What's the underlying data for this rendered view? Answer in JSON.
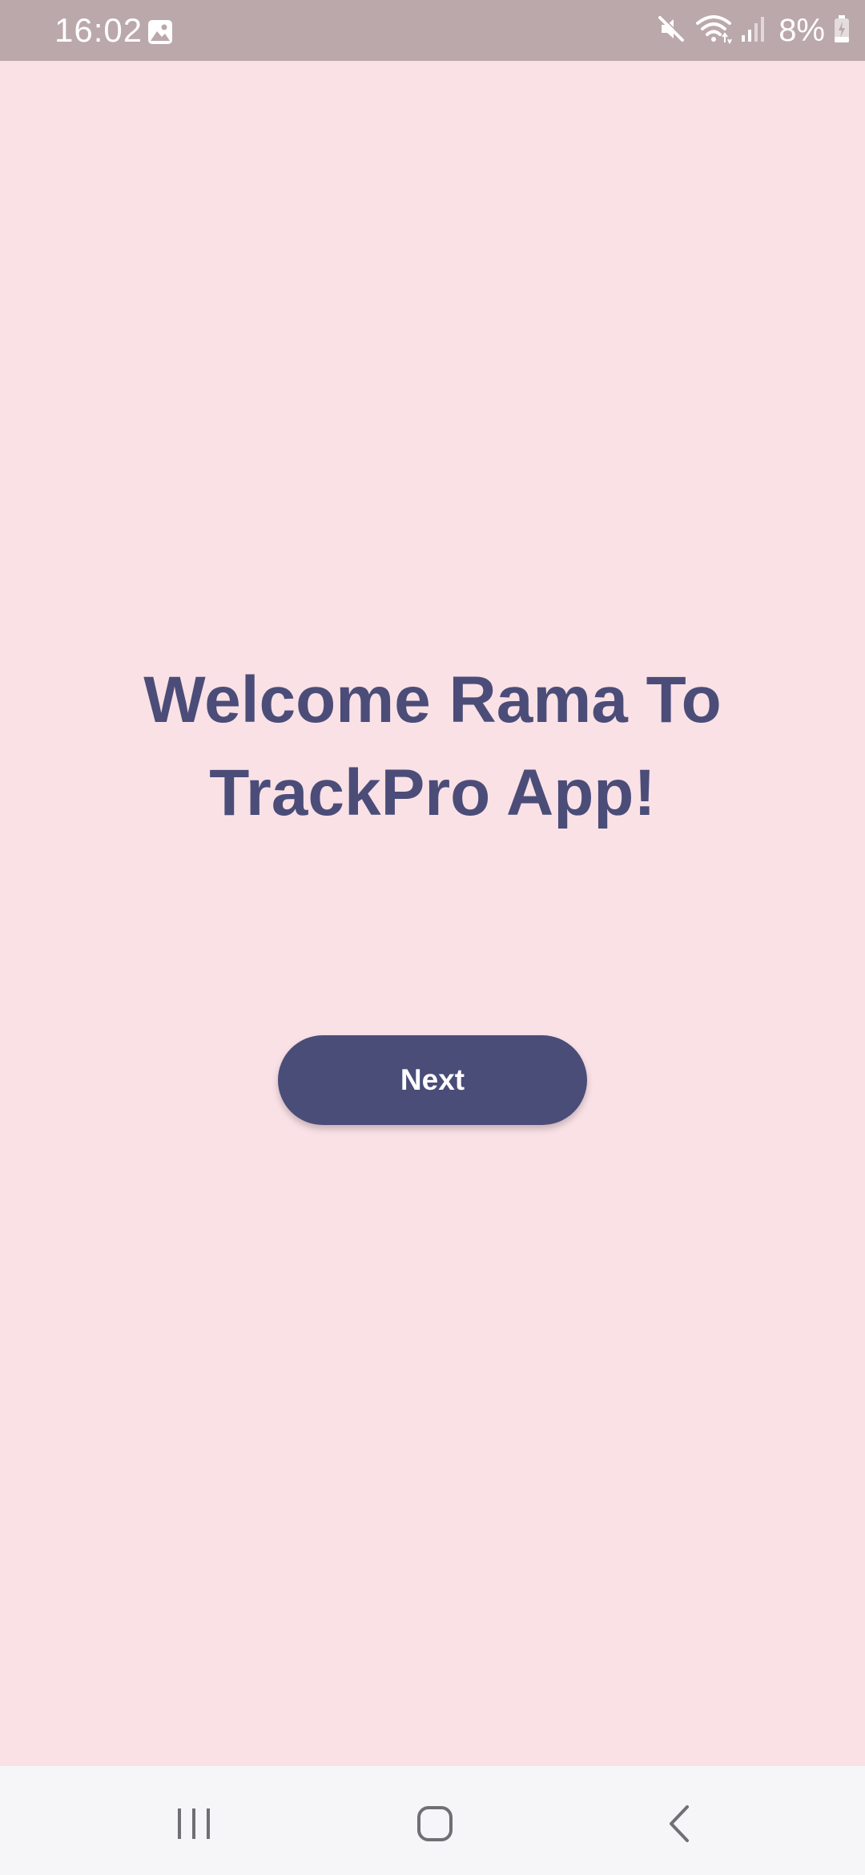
{
  "status_bar": {
    "time": "16:02",
    "battery": "8%",
    "icons": [
      "gallery-icon",
      "mute-icon",
      "wifi-icon",
      "signal-icon",
      "battery-charging-icon"
    ],
    "background": "#bba8aa"
  },
  "main": {
    "title": "Welcome Rama To TrackPro App!",
    "next_label": "Next",
    "background": "#f9e1e6",
    "accent": "#4a4d78"
  },
  "nav_bar": {
    "icons": [
      "recent-apps-icon",
      "home-icon",
      "back-icon"
    ]
  }
}
